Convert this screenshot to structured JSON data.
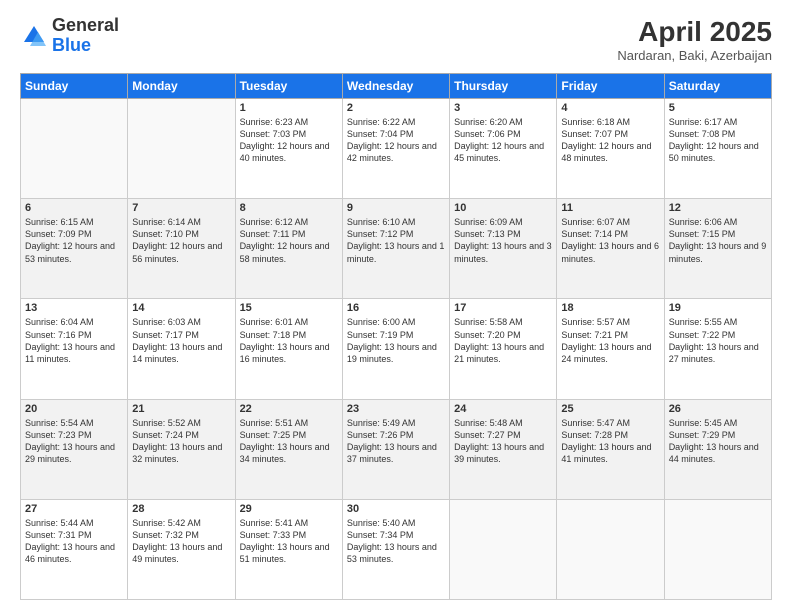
{
  "header": {
    "logo_general": "General",
    "logo_blue": "Blue",
    "title": "April 2025",
    "subtitle": "Nardaran, Baki, Azerbaijan"
  },
  "days_of_week": [
    "Sunday",
    "Monday",
    "Tuesday",
    "Wednesday",
    "Thursday",
    "Friday",
    "Saturday"
  ],
  "weeks": [
    [
      {
        "day": "",
        "info": ""
      },
      {
        "day": "",
        "info": ""
      },
      {
        "day": "1",
        "info": "Sunrise: 6:23 AM\nSunset: 7:03 PM\nDaylight: 12 hours and 40 minutes."
      },
      {
        "day": "2",
        "info": "Sunrise: 6:22 AM\nSunset: 7:04 PM\nDaylight: 12 hours and 42 minutes."
      },
      {
        "day": "3",
        "info": "Sunrise: 6:20 AM\nSunset: 7:06 PM\nDaylight: 12 hours and 45 minutes."
      },
      {
        "day": "4",
        "info": "Sunrise: 6:18 AM\nSunset: 7:07 PM\nDaylight: 12 hours and 48 minutes."
      },
      {
        "day": "5",
        "info": "Sunrise: 6:17 AM\nSunset: 7:08 PM\nDaylight: 12 hours and 50 minutes."
      }
    ],
    [
      {
        "day": "6",
        "info": "Sunrise: 6:15 AM\nSunset: 7:09 PM\nDaylight: 12 hours and 53 minutes."
      },
      {
        "day": "7",
        "info": "Sunrise: 6:14 AM\nSunset: 7:10 PM\nDaylight: 12 hours and 56 minutes."
      },
      {
        "day": "8",
        "info": "Sunrise: 6:12 AM\nSunset: 7:11 PM\nDaylight: 12 hours and 58 minutes."
      },
      {
        "day": "9",
        "info": "Sunrise: 6:10 AM\nSunset: 7:12 PM\nDaylight: 13 hours and 1 minute."
      },
      {
        "day": "10",
        "info": "Sunrise: 6:09 AM\nSunset: 7:13 PM\nDaylight: 13 hours and 3 minutes."
      },
      {
        "day": "11",
        "info": "Sunrise: 6:07 AM\nSunset: 7:14 PM\nDaylight: 13 hours and 6 minutes."
      },
      {
        "day": "12",
        "info": "Sunrise: 6:06 AM\nSunset: 7:15 PM\nDaylight: 13 hours and 9 minutes."
      }
    ],
    [
      {
        "day": "13",
        "info": "Sunrise: 6:04 AM\nSunset: 7:16 PM\nDaylight: 13 hours and 11 minutes."
      },
      {
        "day": "14",
        "info": "Sunrise: 6:03 AM\nSunset: 7:17 PM\nDaylight: 13 hours and 14 minutes."
      },
      {
        "day": "15",
        "info": "Sunrise: 6:01 AM\nSunset: 7:18 PM\nDaylight: 13 hours and 16 minutes."
      },
      {
        "day": "16",
        "info": "Sunrise: 6:00 AM\nSunset: 7:19 PM\nDaylight: 13 hours and 19 minutes."
      },
      {
        "day": "17",
        "info": "Sunrise: 5:58 AM\nSunset: 7:20 PM\nDaylight: 13 hours and 21 minutes."
      },
      {
        "day": "18",
        "info": "Sunrise: 5:57 AM\nSunset: 7:21 PM\nDaylight: 13 hours and 24 minutes."
      },
      {
        "day": "19",
        "info": "Sunrise: 5:55 AM\nSunset: 7:22 PM\nDaylight: 13 hours and 27 minutes."
      }
    ],
    [
      {
        "day": "20",
        "info": "Sunrise: 5:54 AM\nSunset: 7:23 PM\nDaylight: 13 hours and 29 minutes."
      },
      {
        "day": "21",
        "info": "Sunrise: 5:52 AM\nSunset: 7:24 PM\nDaylight: 13 hours and 32 minutes."
      },
      {
        "day": "22",
        "info": "Sunrise: 5:51 AM\nSunset: 7:25 PM\nDaylight: 13 hours and 34 minutes."
      },
      {
        "day": "23",
        "info": "Sunrise: 5:49 AM\nSunset: 7:26 PM\nDaylight: 13 hours and 37 minutes."
      },
      {
        "day": "24",
        "info": "Sunrise: 5:48 AM\nSunset: 7:27 PM\nDaylight: 13 hours and 39 minutes."
      },
      {
        "day": "25",
        "info": "Sunrise: 5:47 AM\nSunset: 7:28 PM\nDaylight: 13 hours and 41 minutes."
      },
      {
        "day": "26",
        "info": "Sunrise: 5:45 AM\nSunset: 7:29 PM\nDaylight: 13 hours and 44 minutes."
      }
    ],
    [
      {
        "day": "27",
        "info": "Sunrise: 5:44 AM\nSunset: 7:31 PM\nDaylight: 13 hours and 46 minutes."
      },
      {
        "day": "28",
        "info": "Sunrise: 5:42 AM\nSunset: 7:32 PM\nDaylight: 13 hours and 49 minutes."
      },
      {
        "day": "29",
        "info": "Sunrise: 5:41 AM\nSunset: 7:33 PM\nDaylight: 13 hours and 51 minutes."
      },
      {
        "day": "30",
        "info": "Sunrise: 5:40 AM\nSunset: 7:34 PM\nDaylight: 13 hours and 53 minutes."
      },
      {
        "day": "",
        "info": ""
      },
      {
        "day": "",
        "info": ""
      },
      {
        "day": "",
        "info": ""
      }
    ]
  ]
}
